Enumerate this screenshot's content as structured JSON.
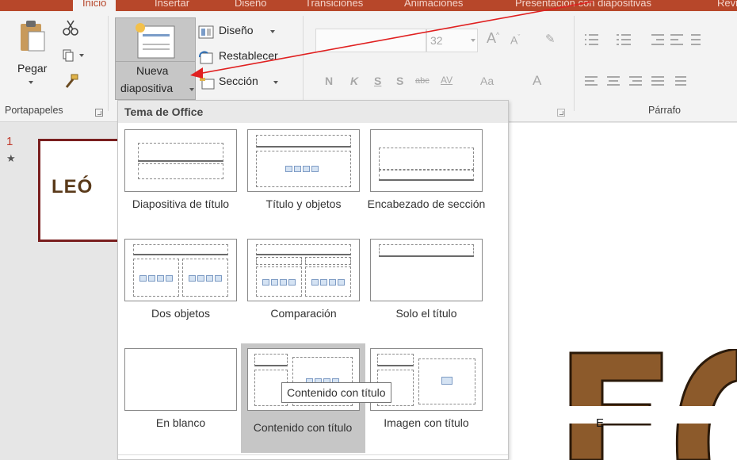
{
  "tabs": {
    "items": [
      "Inicio",
      "Insertar",
      "Diseño",
      "Transiciones",
      "Animaciones",
      "Presentación con diapositivas",
      "Revisar"
    ]
  },
  "ribbon": {
    "portapapeles": {
      "label": "Portapapeles",
      "paste": "Pegar"
    },
    "diapositivas": {
      "new_slide_line1": "Nueva",
      "new_slide_line2": "diapositiva",
      "layout": "Diseño",
      "reset": "Restablecer",
      "section": "Sección"
    },
    "fuente": {
      "font_size": "32",
      "bold": "N",
      "italic": "K",
      "underline": "S",
      "shadow": "S",
      "strike": "abc",
      "spacing": "AV",
      "case": "Aa",
      "color": "A"
    },
    "parrafo": {
      "label": "Párrafo"
    }
  },
  "slides_pane": {
    "number": "1",
    "star": "★",
    "thumb_text": "LEÓ"
  },
  "gallery": {
    "header": "Tema de Office",
    "layouts": [
      {
        "label": "Diapositiva de título"
      },
      {
        "label": "Título y objetos"
      },
      {
        "label": "Encabezado de sección"
      },
      {
        "label": "Dos objetos"
      },
      {
        "label": "Comparación"
      },
      {
        "label": "Solo el título"
      },
      {
        "label": "En blanco"
      },
      {
        "label": "Contenido con título"
      },
      {
        "label": "Imagen con título"
      }
    ],
    "hovered_index": 7,
    "tooltip": "Contenido con título"
  },
  "canvas": {
    "letter": "E"
  },
  "colors": {
    "accent": "#b7472a",
    "annotation_arrow": "#e02020",
    "art_brown": "#8c5a2b"
  }
}
